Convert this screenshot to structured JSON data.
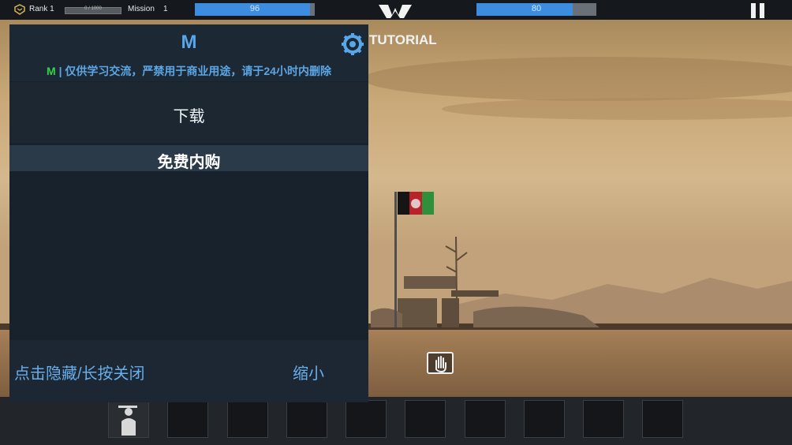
{
  "hud": {
    "rank_label": "Rank 1",
    "rank_xp_text": "0 / 1000",
    "mission_label": "Mission",
    "mission_value": "1",
    "left_bar_value": "96",
    "left_bar_fill": 0.96,
    "right_bar_value": "80",
    "right_bar_fill": 0.8
  },
  "scene": {
    "tutorial_label": "TUTORIAL"
  },
  "menu": {
    "title": "M",
    "notice_mark": "M",
    "notice_text": "| 仅供学习交流，严禁用于商业用途，请于24小时内删除",
    "download_label": "下载",
    "iap_label": "免费内购",
    "hide_close_label": "点击隐藏/长按关闭",
    "minimize_label": "缩小"
  },
  "icons": [
    "rank-badge-icon",
    "winged-logo-icon",
    "pause-icon",
    "settings-gear-icon",
    "hand-icon",
    "soldier-unit-icon"
  ],
  "colors": {
    "accent_blue": "#3c8de0",
    "menu_text_blue": "#58a7ea",
    "notice_green": "#33d24a"
  }
}
